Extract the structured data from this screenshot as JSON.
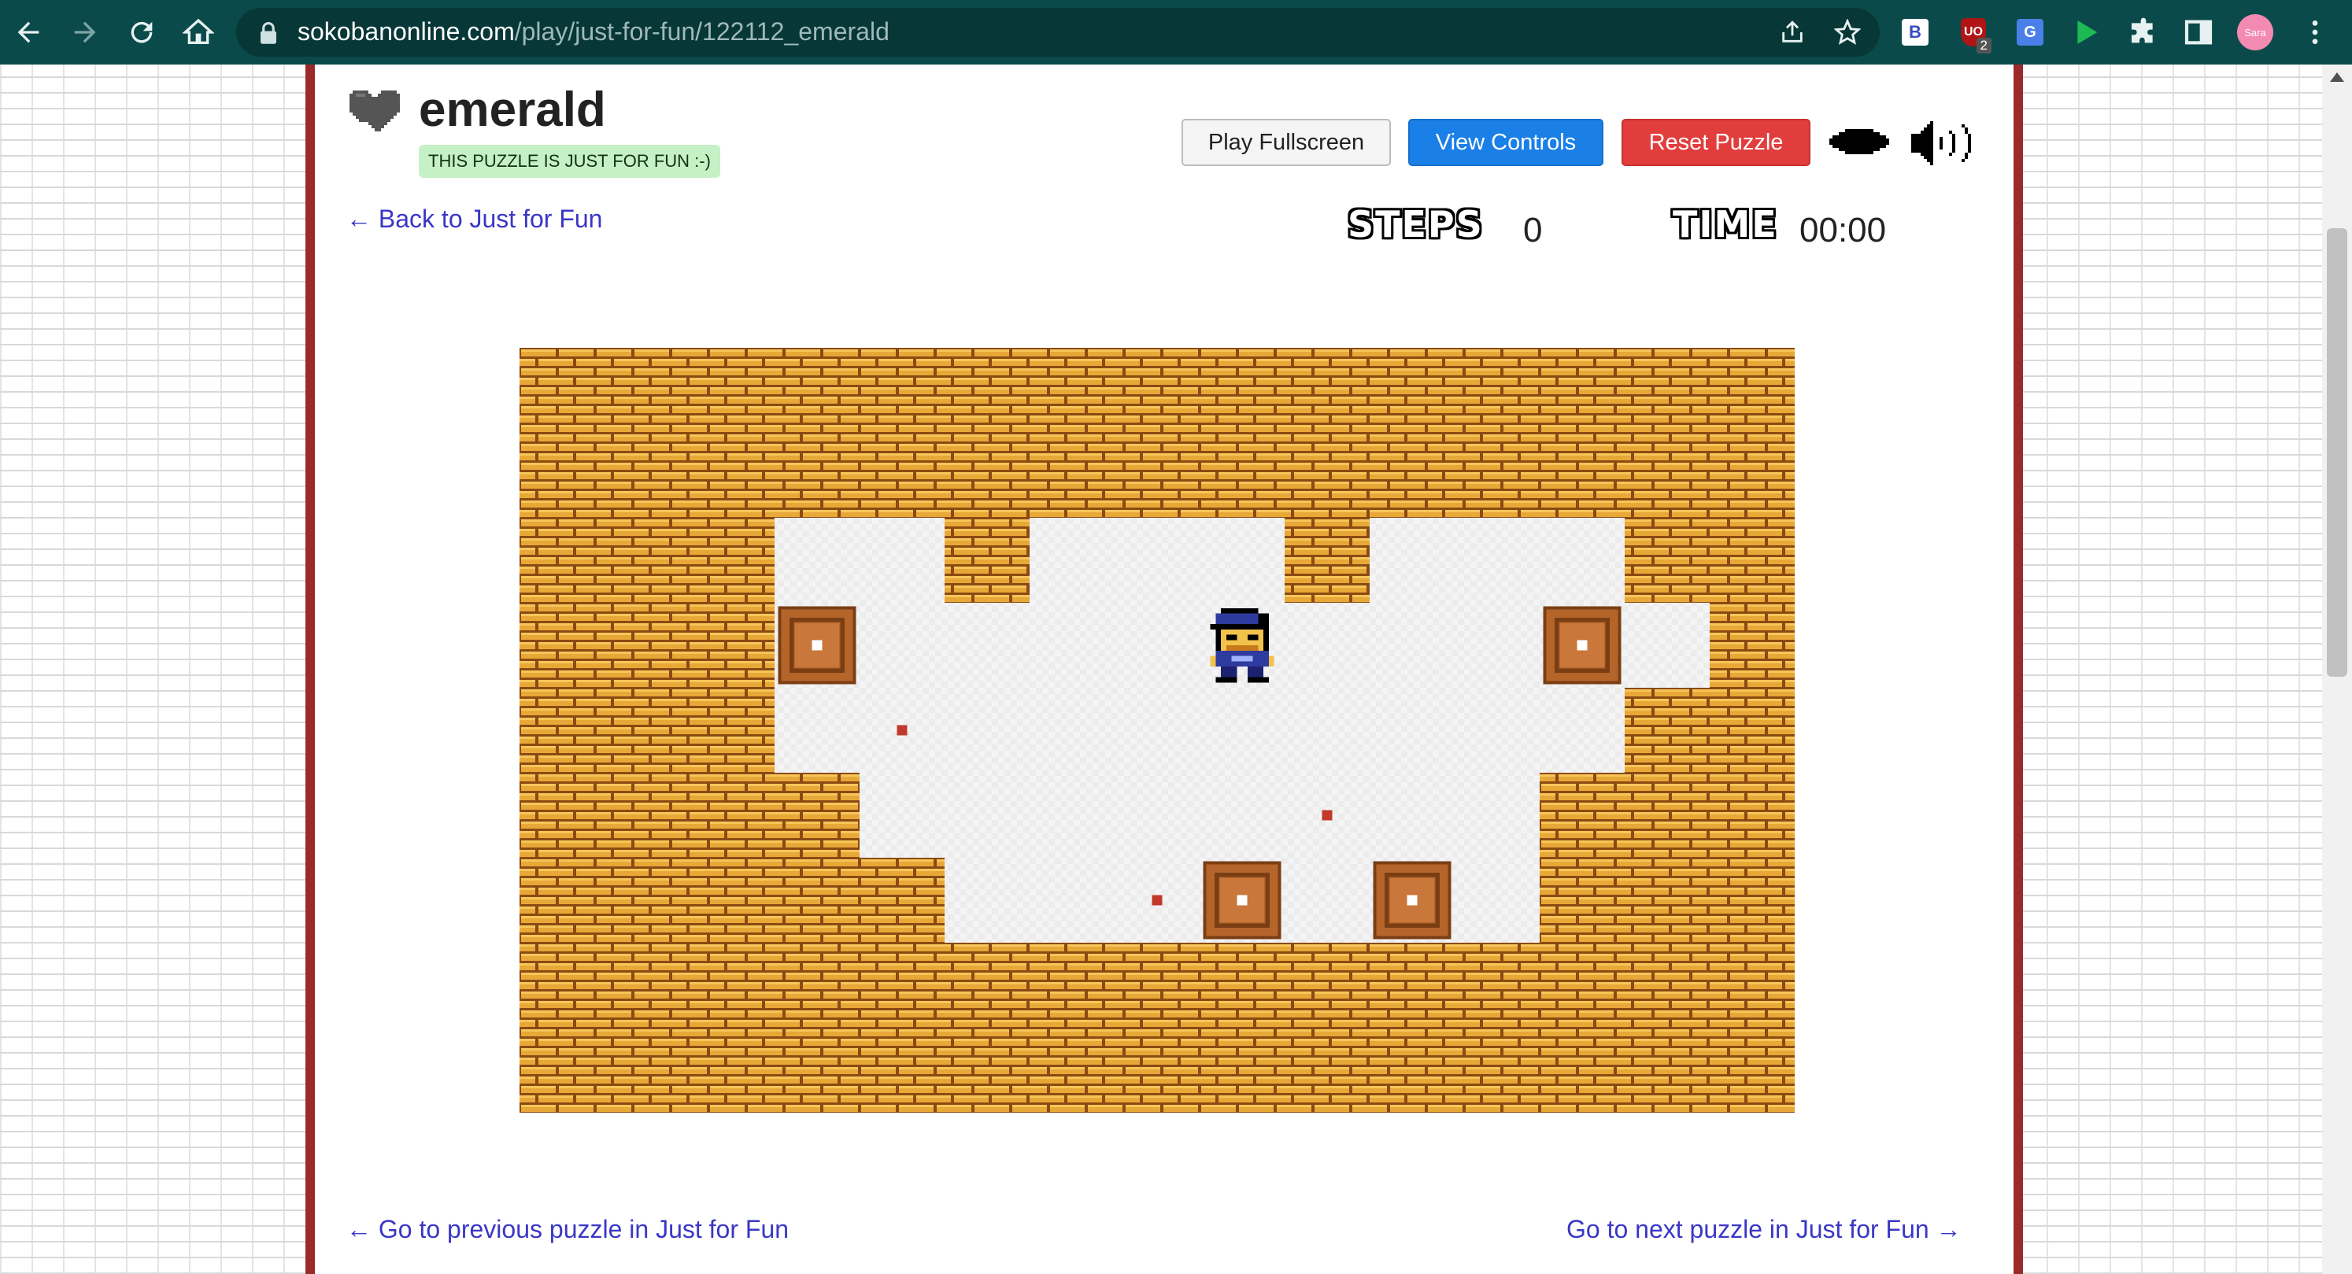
{
  "browser": {
    "url_host": "sokobanonline.com",
    "url_path": "/play/just-for-fun/122112_emerald",
    "extensions": [
      {
        "name": "bitwarden",
        "label": "B"
      },
      {
        "name": "ublock",
        "label": "UO",
        "badge": "2"
      },
      {
        "name": "google-translate",
        "label": "G"
      },
      {
        "name": "play"
      },
      {
        "name": "puzzle"
      },
      {
        "name": "side-panel"
      },
      {
        "name": "profile",
        "label": "Sara"
      }
    ]
  },
  "puzzle": {
    "title": "emerald",
    "badge": "THIS PUZZLE IS JUST FOR FUN :-)",
    "back_link": "← Back to Just for Fun",
    "prev_link": "← Go to previous puzzle in Just for Fun",
    "next_link": "Go to next puzzle in Just for Fun →"
  },
  "toolbar": {
    "play_fullscreen": "Play Fullscreen",
    "view_controls": "View Controls",
    "reset_puzzle": "Reset Puzzle"
  },
  "stats": {
    "steps_label": "STEPS",
    "steps": "0",
    "time_label": "TIME",
    "time": "00:00"
  },
  "colors": {
    "brick": "#e8a838",
    "mortar": "#8b4a12",
    "floor": "#f4f4f4",
    "crate": "#b5652a",
    "goal": "#c0392b",
    "player_cap": "#2f3a9e"
  },
  "game_map": [
    "###############",
    "###############",
    "###  #   #   ##",
    "###$    @   $ #",
    "### .        ##",
    "####     .  ###",
    "#####  .$ $ ###",
    "###############",
    "###############"
  ],
  "board_cols": 15,
  "board_rows": 9
}
